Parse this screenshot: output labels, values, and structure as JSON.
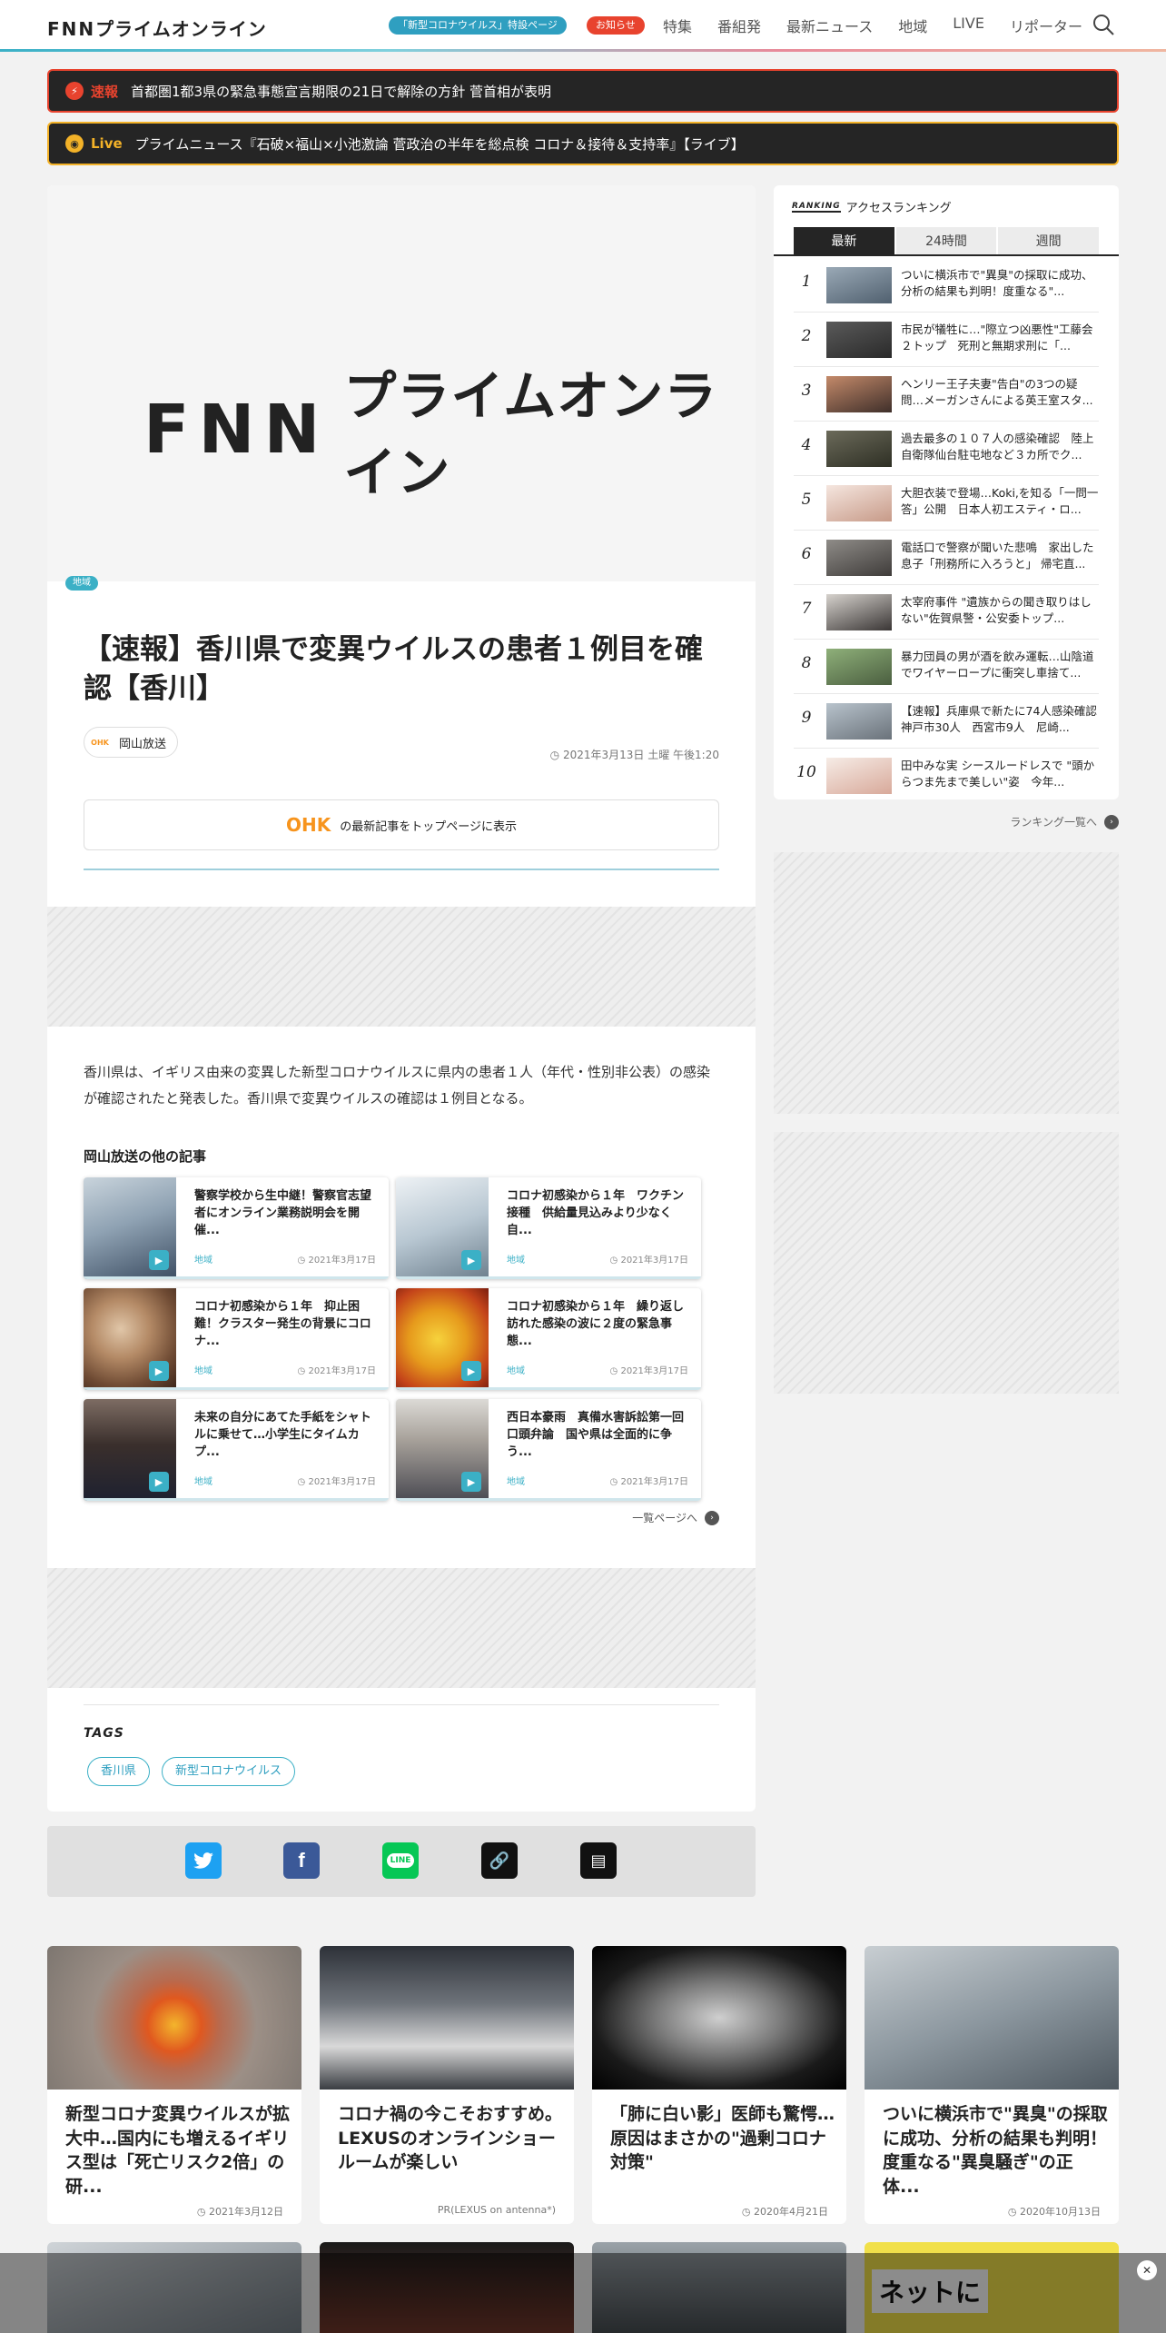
{
  "header": {
    "logo_fnn": "FNN",
    "logo_jp": "プライムオンライン",
    "covid_pill": "「新型コロナウイルス」特設ページ",
    "notice_pill": "お知らせ",
    "nav": [
      "特集",
      "番組発",
      "最新ニュース",
      "地域",
      "LIVE",
      "リポーター"
    ]
  },
  "flash": {
    "breaking_tag": "速報",
    "breaking_text": "首都圏1都3県の緊急事態宣言期限の21日で解除の方針 菅首相が表明",
    "live_tag": "Live",
    "live_text": "プライムニュース『石破×福山×小池激論 菅政治の半年を総点検 コロナ＆接待＆支持率』【ライブ】"
  },
  "article": {
    "hero_logo_fnn": "FNN",
    "hero_logo_jp": "プライムオンライン",
    "category": "地域",
    "title": "【速報】香川県で変異ウイルスの患者１例目を確認【香川】",
    "source_logo": "OHK",
    "source": "岡山放送",
    "date": "2021年3月13日 土曜 午後1:20",
    "top_button_logo": "OHK",
    "top_button_text": "の最新記事をトップページに表示",
    "body": "香川県は、イギリス由来の変異した新型コロナウイルスに県内の患者１人（年代・性別非公表）の感染が確認されたと発表した。香川県で変異ウイルスの確認は１例目となる。"
  },
  "related": {
    "heading": "岡山放送の他の記事",
    "items": [
      {
        "title": "警察学校から生中継！警察官志望者にオンライン業務説明会を開催...",
        "category": "地域",
        "date": "2021年3月17日"
      },
      {
        "title": "コロナ初感染から１年　ワクチン接種　供給量見込みより少なく自...",
        "category": "地域",
        "date": "2021年3月17日"
      },
      {
        "title": "コロナ初感染から１年　抑止困難！クラスター発生の背景にコロナ...",
        "category": "地域",
        "date": "2021年3月17日"
      },
      {
        "title": "コロナ初感染から１年　繰り返し訪れた感染の波に２度の緊急事態...",
        "category": "地域",
        "date": "2021年3月17日"
      },
      {
        "title": "未来の自分にあてた手紙をシャトルに乗せて…小学生にタイムカプ...",
        "category": "地域",
        "date": "2021年3月17日"
      },
      {
        "title": "西日本豪雨　真備水害訴訟第一回口頭弁論　国や県は全面的に争う...",
        "category": "地域",
        "date": "2021年3月17日"
      }
    ],
    "more": "一覧ページへ"
  },
  "tags": {
    "heading": "TAGS",
    "items": [
      "香川県",
      "新型コロナウイルス"
    ]
  },
  "share": {
    "buttons": [
      "twitter",
      "facebook",
      "line",
      "copy-link",
      "comment"
    ]
  },
  "ranking": {
    "badge": "RANKING",
    "heading": "アクセスランキング",
    "tabs": [
      "最新",
      "24時間",
      "週間"
    ],
    "active_tab": "最新",
    "items": [
      {
        "rank": "1",
        "title": "ついに横浜市で\"異臭\"の採取に成功、分析の結果も判明！度重なる\"..."
      },
      {
        "rank": "2",
        "title": "市民が犠牲に…\"際立つ凶悪性\"工藤会２トップ　死刑と無期求刑に「..."
      },
      {
        "rank": "3",
        "title": "ヘンリー王子夫妻\"告白\"の3つの疑問…メーガンさんによる英王室スタ..."
      },
      {
        "rank": "4",
        "title": "過去最多の１０７人の感染確認　陸上自衛隊仙台駐屯地など３カ所でク..."
      },
      {
        "rank": "5",
        "title": "大胆衣装で登場…Koki,を知る「一問一答」公開　日本人初エスティ・ロ..."
      },
      {
        "rank": "6",
        "title": "電話口で警察が聞いた悲鳴　家出した息子「刑務所に入ろうと」 帰宅直..."
      },
      {
        "rank": "7",
        "title": "太宰府事件 \"遺族からの聞き取りはしない\"佐賀県警・公安委トップ..."
      },
      {
        "rank": "8",
        "title": "暴力団員の男が酒を飲み運転…山陰道でワイヤーロープに衝突し車捨て..."
      },
      {
        "rank": "9",
        "title": "【速報】兵庫県で新たに74人感染確認　神戸市30人　西宮市9人　尼崎..."
      },
      {
        "rank": "10",
        "title": "田中みな実 シースルードレスで \"頭からつま先まで美しい\"姿　今年..."
      }
    ],
    "more": "ランキング一覧へ"
  },
  "bottom_cards": [
    {
      "title": "新型コロナ変異ウイルスが拡大中…国内にも増えるイギリス型は「死亡リスク2倍」の研...",
      "date": "2021年3月12日"
    },
    {
      "title": "コロナ禍の今こそおすすめ。LEXUSのオンラインショールームが楽しい",
      "date": "PR(LEXUS on antenna*)"
    },
    {
      "title": "「肺に白い影」医師も驚愕…原因はまさかの\"過剰コロナ対策\"",
      "date": "2020年4月21日"
    },
    {
      "title": "ついに横浜市で\"異臭\"の採取に成功、分析の結果も判明！度重なる\"異臭騒ぎ\"の正体...",
      "date": "2020年10月13日"
    }
  ],
  "bottom_partial": {
    "card4_text": "ネットに"
  },
  "colors": {
    "accent": "#3bb0c6",
    "breaking": "#e8432e",
    "live": "#f3b228",
    "ohk": "#f7941d"
  }
}
